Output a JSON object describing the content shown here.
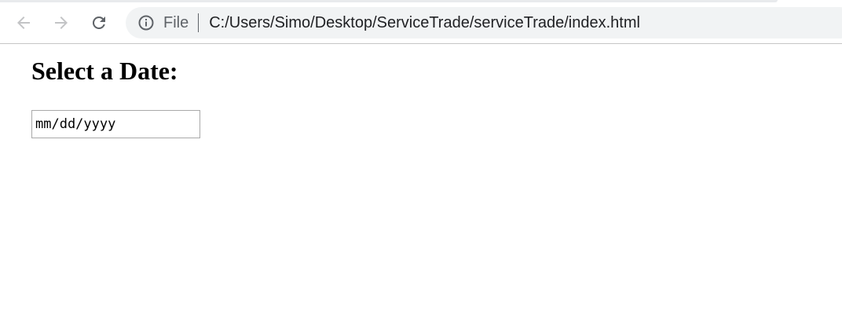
{
  "browser": {
    "address_bar": {
      "scheme_label": "File",
      "url": "C:/Users/Simo/Desktop/ServiceTrade/serviceTrade/index.html"
    },
    "icons": {
      "back": "back-arrow-icon",
      "forward": "forward-arrow-icon",
      "reload": "reload-icon",
      "info": "info-icon"
    }
  },
  "page": {
    "heading": "Select a Date:",
    "date_input": {
      "placeholder": "mm/dd/yyyy"
    }
  }
}
